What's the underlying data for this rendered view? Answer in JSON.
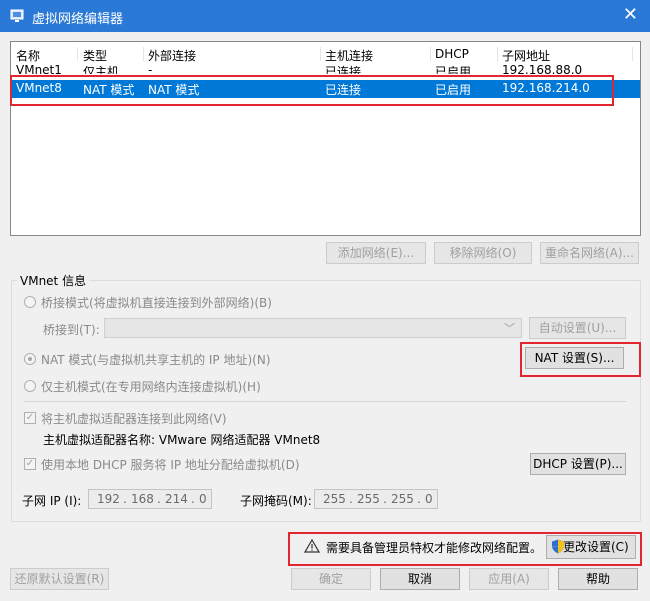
{
  "window": {
    "title": "虚拟网络编辑器",
    "close_glyph": "✕"
  },
  "table": {
    "headers": [
      "名称",
      "类型",
      "外部连接",
      "主机连接",
      "DHCP",
      "子网地址"
    ],
    "rows": [
      [
        "VMnet1",
        "仅主机...",
        "-",
        "已连接",
        "已启用",
        "192.168.88.0"
      ],
      [
        "VMnet8",
        "NAT 模式",
        "NAT 模式",
        "已连接",
        "已启用",
        "192.168.214.0"
      ]
    ],
    "selected_row": 1
  },
  "net_buttons": {
    "add": "添加网络(E)...",
    "remove": "移除网络(O)",
    "rename": "重命名网络(A)..."
  },
  "vmnet_info": {
    "group_label": "VMnet 信息",
    "bridge_radio": "桥接模式(将虚拟机直接连接到外部网络)(B)",
    "bridge_to_label": "桥接到(T):",
    "bridge_to_value": "",
    "auto_settings": "自动设置(U)...",
    "nat_radio": "NAT 模式(与虚拟机共享主机的 IP 地址)(N)",
    "nat_settings": "NAT 设置(S)...",
    "host_only_radio": "仅主机模式(在专用网络内连接虚拟机)(H)",
    "connect_adapter_check": "将主机虚拟适配器连接到此网络(V)",
    "adapter_name": "主机虚拟适配器名称: VMware 网络适配器 VMnet8",
    "dhcp_check": "使用本地 DHCP 服务将 IP 地址分配给虚拟机(D)",
    "dhcp_settings": "DHCP 设置(P)...",
    "subnet_ip_label": "子网 IP (I):",
    "subnet_ip": [
      "192",
      "168",
      "214",
      "0"
    ],
    "subnet_mask_label": "子网掩码(M):",
    "subnet_mask": [
      "255",
      "255",
      "255",
      "0"
    ]
  },
  "admin_notice": {
    "text": "需要具备管理员特权才能修改网络配置。",
    "change_button": "更改设置(C)"
  },
  "footer": {
    "restore": "还原默认设置(R)",
    "ok": "确定",
    "cancel": "取消",
    "apply": "应用(A)",
    "help": "帮助"
  },
  "colors": {
    "title_bar": "#2b79d6",
    "selection": "#0078d7",
    "highlight_box": "#e0262e"
  }
}
